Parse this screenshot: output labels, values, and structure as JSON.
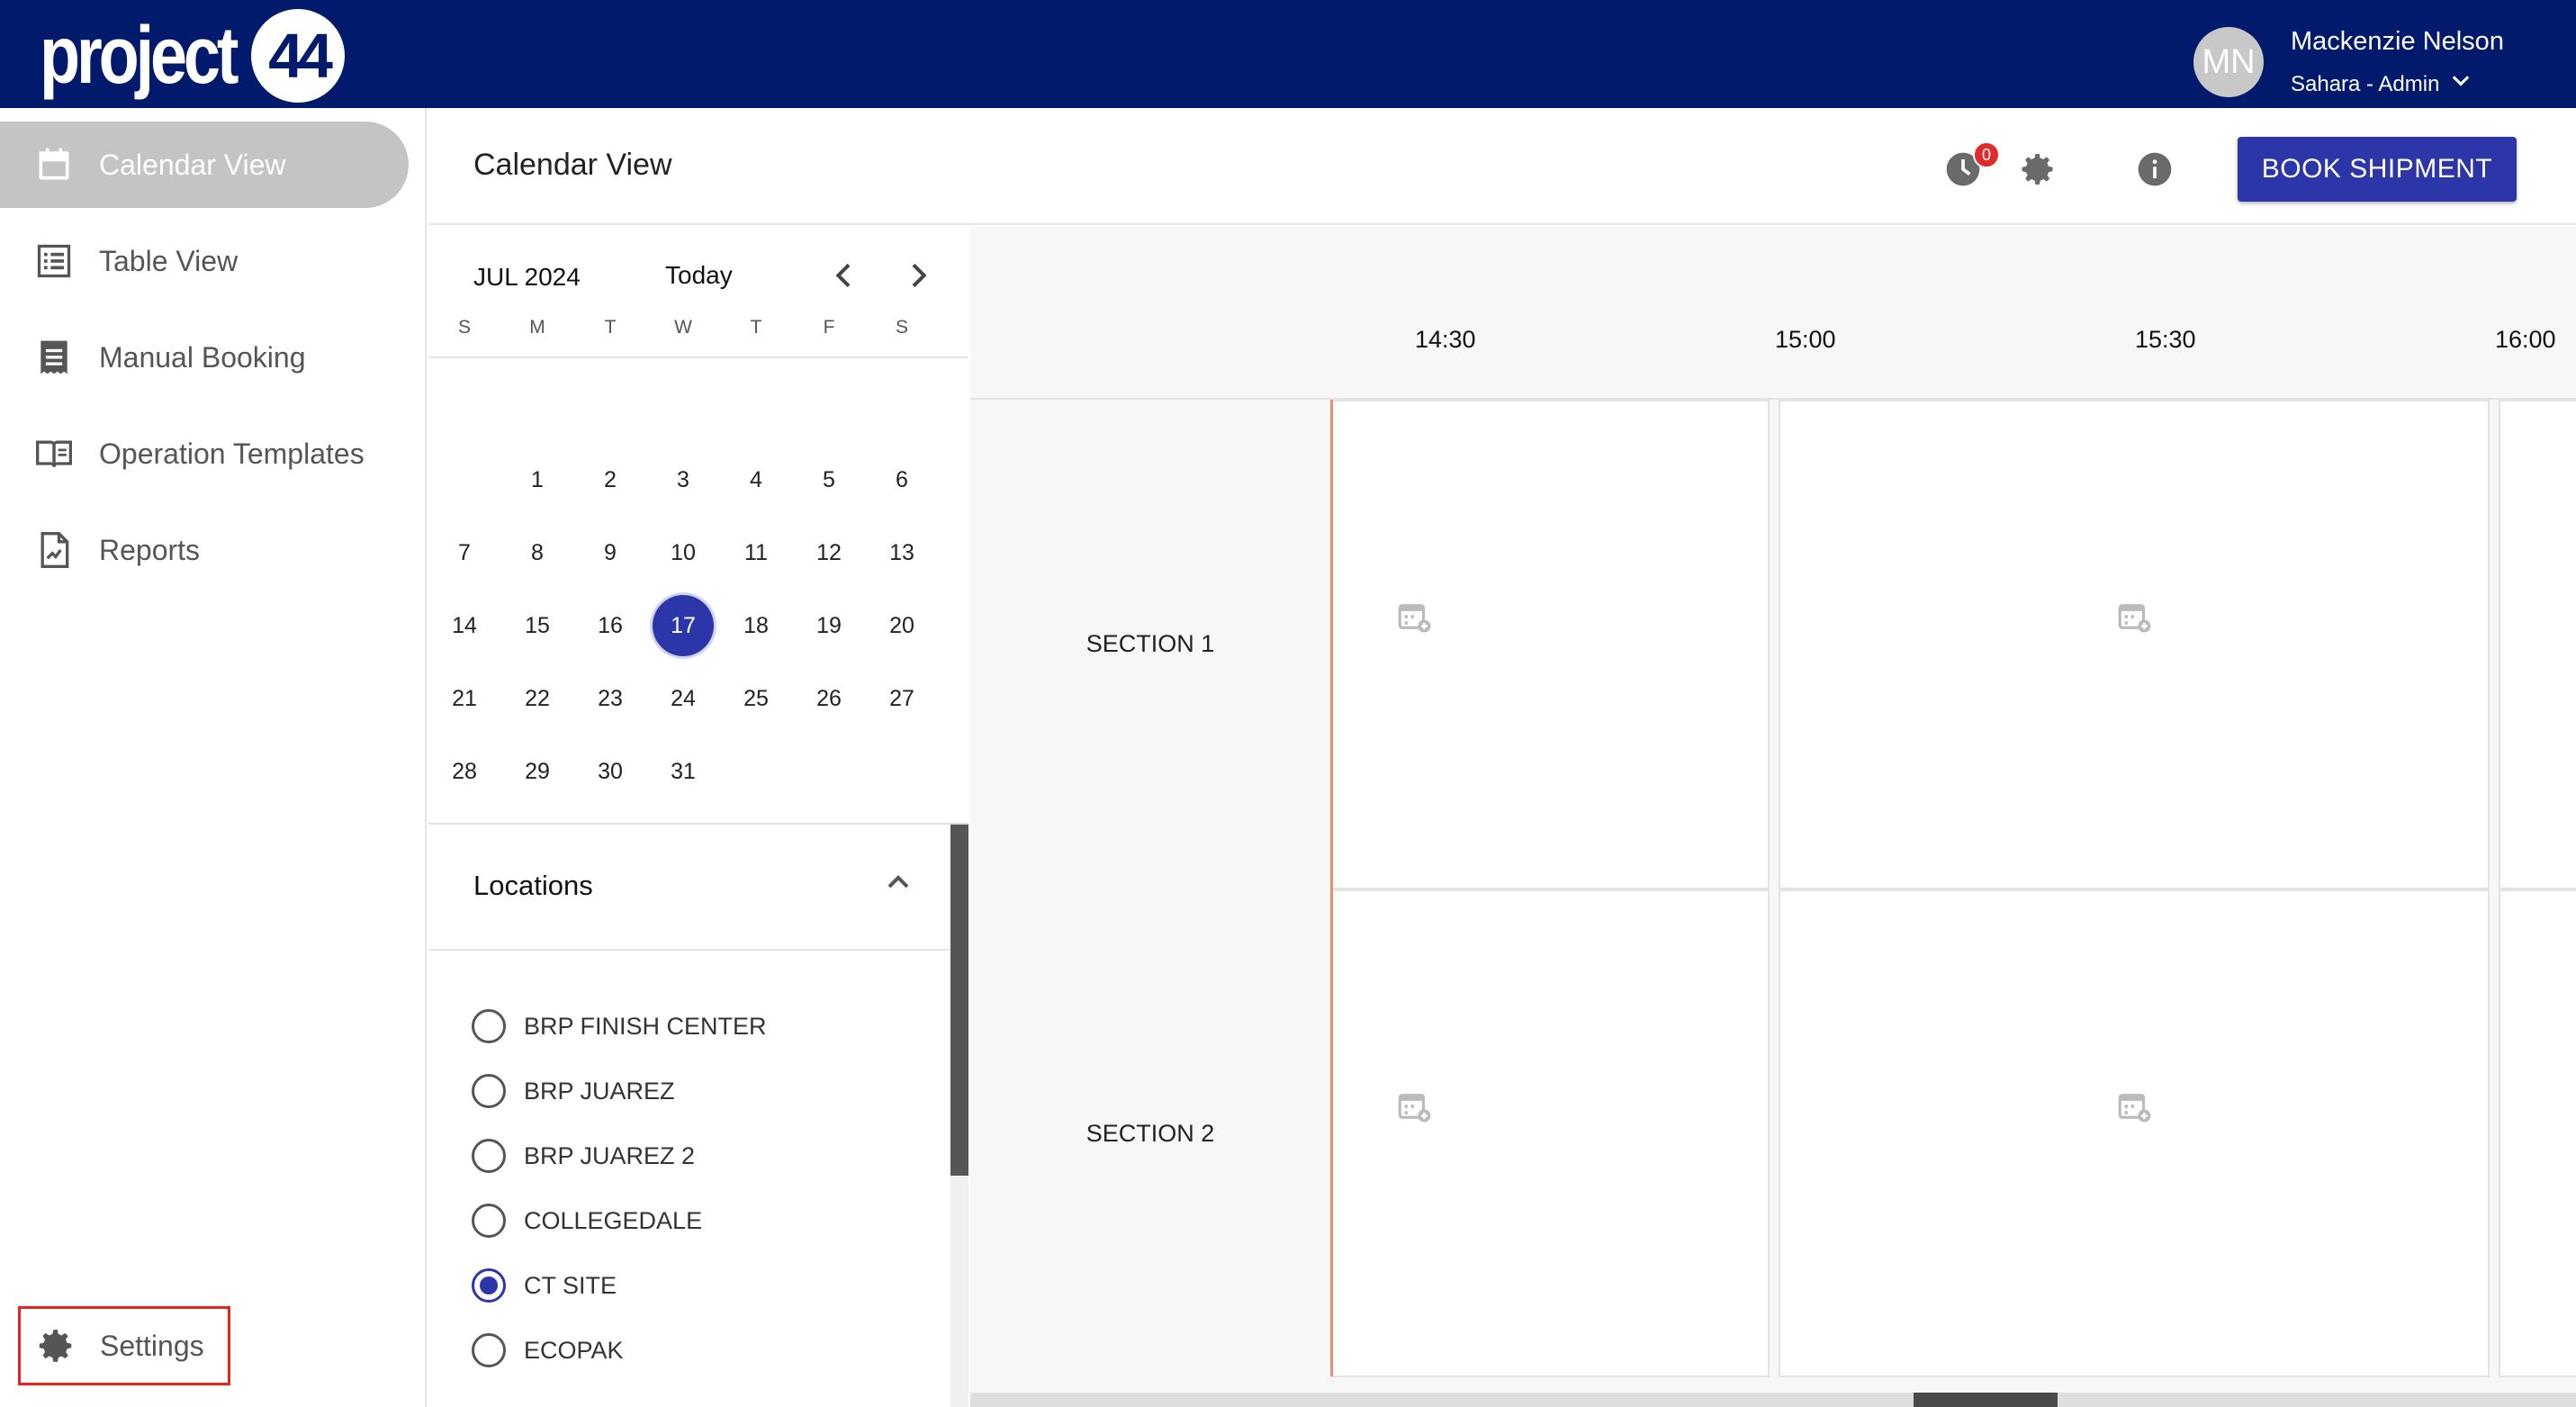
{
  "app": {
    "logo_text": "project",
    "logo_number": "44"
  },
  "user": {
    "initials": "MN",
    "name": "Mackenzie Nelson",
    "role": "Sahara - Admin"
  },
  "sidebar": {
    "items": [
      {
        "label": "Calendar View",
        "icon": "calendar-icon",
        "active": true
      },
      {
        "label": "Table View",
        "icon": "list-icon",
        "active": false
      },
      {
        "label": "Manual Booking",
        "icon": "receipt-icon",
        "active": false
      },
      {
        "label": "Operation Templates",
        "icon": "book-icon",
        "active": false
      },
      {
        "label": "Reports",
        "icon": "report-icon",
        "active": false
      }
    ],
    "settings_label": "Settings"
  },
  "header": {
    "title": "Calendar View",
    "notification_count": "0",
    "book_button": "BOOK SHIPMENT"
  },
  "mini_calendar": {
    "month_label": "JUL 2024",
    "today_label": "Today",
    "weekdays": [
      "S",
      "M",
      "T",
      "W",
      "T",
      "F",
      "S"
    ],
    "first_weekday_index": 1,
    "days_in_month": 31,
    "selected_day": 17
  },
  "locations": {
    "title": "Locations",
    "items": [
      {
        "label": "BRP FINISH CENTER",
        "checked": false
      },
      {
        "label": "BRP JUAREZ",
        "checked": false
      },
      {
        "label": "BRP JUAREZ 2",
        "checked": false
      },
      {
        "label": "COLLEGEDALE",
        "checked": false
      },
      {
        "label": "CT SITE",
        "checked": true
      },
      {
        "label": "ECOPAK",
        "checked": false
      }
    ]
  },
  "schedule": {
    "times": [
      "14:30",
      "15:00",
      "15:30",
      "16:00"
    ],
    "sections": [
      "SECTION 1",
      "SECTION 2"
    ]
  },
  "colors": {
    "topbar": "#011a6b",
    "accent": "#2c36a8",
    "badge": "#e12a2a",
    "now_line": "#f08a6e"
  }
}
